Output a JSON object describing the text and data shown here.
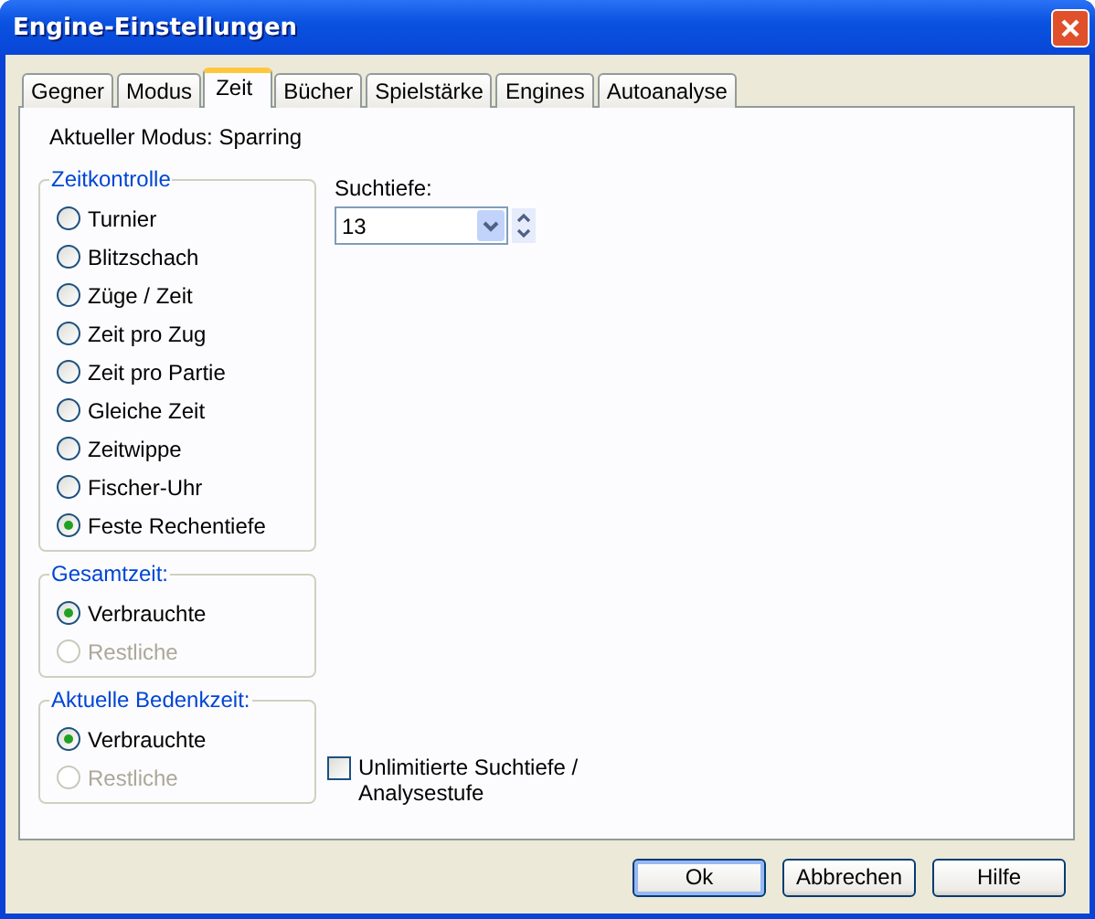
{
  "window": {
    "title": "Engine-Einstellungen"
  },
  "tabs": [
    {
      "label": "Gegner",
      "selected": false
    },
    {
      "label": "Modus",
      "selected": false
    },
    {
      "label": "Zeit",
      "selected": true
    },
    {
      "label": "Bücher",
      "selected": false
    },
    {
      "label": "Spielstärke",
      "selected": false
    },
    {
      "label": "Engines",
      "selected": false
    },
    {
      "label": "Autoanalyse",
      "selected": false
    }
  ],
  "current_mode": "Aktueller Modus: Sparring",
  "groups": [
    {
      "title": "Zeitkontrolle",
      "options": [
        {
          "label": "Turnier",
          "selected": false,
          "disabled": false
        },
        {
          "label": "Blitzschach",
          "selected": false,
          "disabled": false
        },
        {
          "label": "Züge / Zeit",
          "selected": false,
          "disabled": false
        },
        {
          "label": "Zeit pro Zug",
          "selected": false,
          "disabled": false
        },
        {
          "label": "Zeit pro Partie",
          "selected": false,
          "disabled": false
        },
        {
          "label": "Gleiche Zeit",
          "selected": false,
          "disabled": false
        },
        {
          "label": "Zeitwippe",
          "selected": false,
          "disabled": false
        },
        {
          "label": "Fischer-Uhr",
          "selected": false,
          "disabled": false
        },
        {
          "label": "Feste Rechentiefe",
          "selected": true,
          "disabled": false
        }
      ]
    },
    {
      "title": "Gesamtzeit:",
      "options": [
        {
          "label": "Verbrauchte",
          "selected": true,
          "disabled": false
        },
        {
          "label": "Restliche",
          "selected": false,
          "disabled": true
        }
      ]
    },
    {
      "title": "Aktuelle Bedenkzeit:",
      "options": [
        {
          "label": "Verbrauchte",
          "selected": true,
          "disabled": false
        },
        {
          "label": "Restliche",
          "selected": false,
          "disabled": true
        }
      ]
    }
  ],
  "search_depth": {
    "label": "Suchtiefe:",
    "value": "13"
  },
  "unlimited": {
    "label": "Unlimitierte Suchtiefe / Analysestufe",
    "checked": false
  },
  "buttons": [
    {
      "label": "Ok",
      "default": true
    },
    {
      "label": "Abbrechen",
      "default": false
    },
    {
      "label": "Hilfe",
      "default": false
    }
  ]
}
